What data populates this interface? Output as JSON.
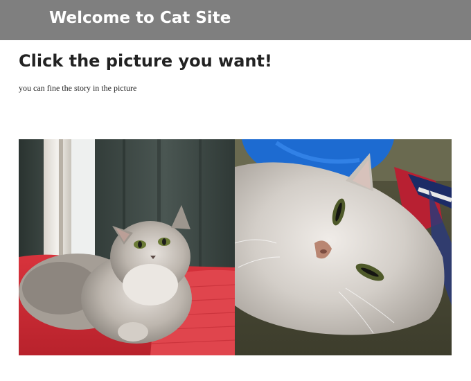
{
  "header": {
    "title": "Welcome to Cat Site",
    "background": "#7f7f7f"
  },
  "main": {
    "heading": "Click the picture you want!",
    "subtitle": "you can fine the story in the picture"
  },
  "gallery": [
    {
      "subject": "fluffy silver cat sitting on red blanket by curtains"
    },
    {
      "subject": "fluffy silver cat lying on its side, close-up"
    }
  ]
}
